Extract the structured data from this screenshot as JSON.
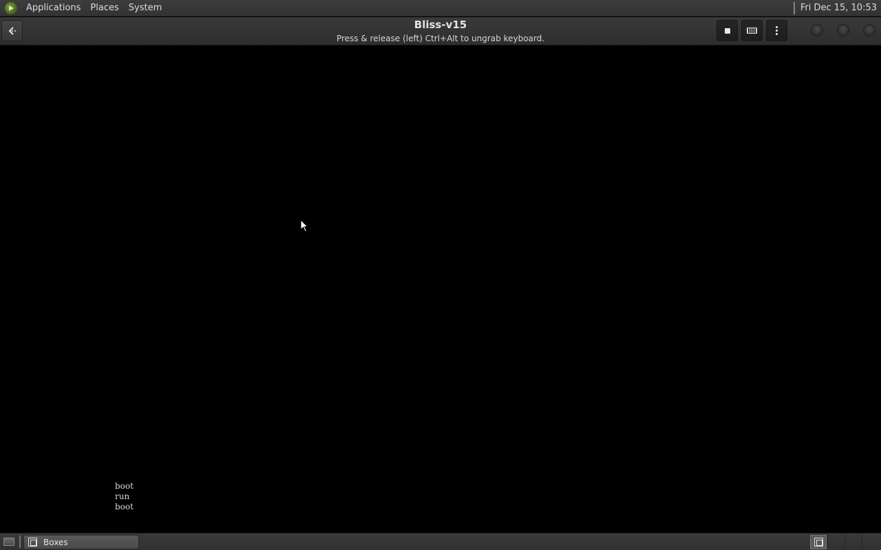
{
  "top_panel": {
    "menus": [
      "Applications",
      "Places",
      "System"
    ],
    "clock": "Fri Dec 15, 10:53"
  },
  "header_bar": {
    "title": "Bliss-v15",
    "subtitle": "Press & release (left) Ctrl+Alt to ungrab keyboard.",
    "buttons": {
      "back": "go-back-icon",
      "fullscreen": "fullscreen-icon",
      "keys": "keyboard-icon",
      "menu": "more-options-icon"
    }
  },
  "vm_display": {
    "console_lines": [
      "boot",
      "run",
      "boot"
    ]
  },
  "bottom_panel": {
    "task": "Boxes",
    "workspaces": 4
  },
  "colors": {
    "panel_bg": "#363636",
    "header_bg": "#333333",
    "display_bg": "#000000",
    "text": "#dcdcdc"
  }
}
